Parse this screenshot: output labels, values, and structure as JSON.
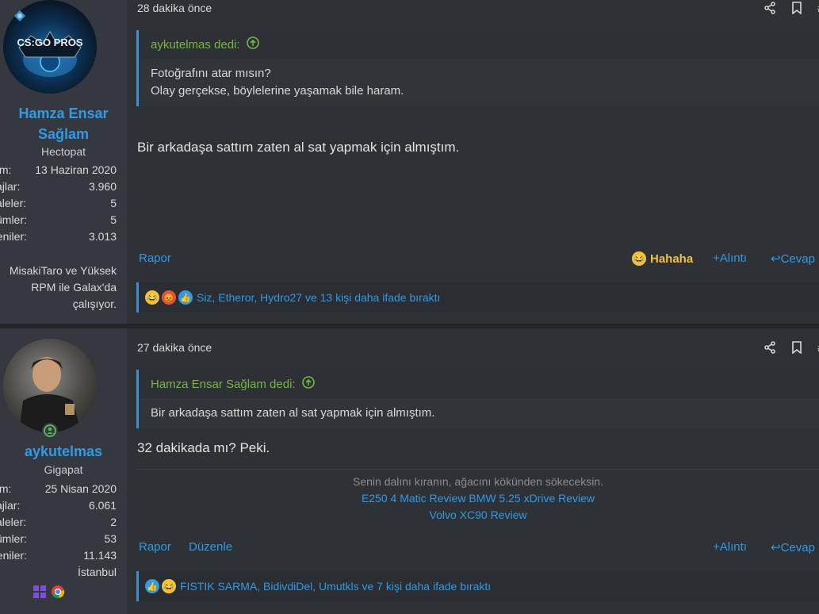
{
  "posts": [
    {
      "user": {
        "name_line1": "Hamza Ensar",
        "name_line2": "Sağlam",
        "title": "Hectopat"
      },
      "stats": [
        {
          "key": "ılım:",
          "value": "13 Haziran 2020"
        },
        {
          "key": "sajlar:",
          "value": "3.960"
        },
        {
          "key": "kaleler:",
          "value": "5"
        },
        {
          "key": "zümler:",
          "value": "5"
        },
        {
          "key": "ğeniler:",
          "value": "3.013"
        },
        {
          "key": ":",
          "value": ""
        }
      ],
      "extra_lines": [
        "MisakiTaro ve Yüksek",
        "RPM ile Galax'da",
        "çalışıyor."
      ],
      "time": "28 dakika önce",
      "quote": {
        "author": "aykutelmas dedi:",
        "lines": [
          "Fotoğrafını atar mısın?",
          "Olay gerçekse, böylelerine yaşamak bile haram."
        ]
      },
      "message": "Bir arkadaşa sattım zaten al sat yapmak için almıştım.",
      "actions": {
        "report": "Rapor",
        "reaction": "Hahaha",
        "quote": "Alıntı",
        "reply": "Cevap"
      },
      "reactions_text": "Siz, Etheror, Hydro27 ve 13 kişi daha ifade bıraktı"
    },
    {
      "user": {
        "name_line1": "aykutelmas",
        "title": "Gigapat"
      },
      "stats": [
        {
          "key": "ılım:",
          "value": "25 Nisan 2020"
        },
        {
          "key": "sajlar:",
          "value": "6.061"
        },
        {
          "key": "kaleler:",
          "value": "2"
        },
        {
          "key": "zümler:",
          "value": "53"
        },
        {
          "key": "ğeniler:",
          "value": "11.143"
        },
        {
          "key": ":",
          "value": "İstanbul"
        }
      ],
      "time": "27 dakika önce",
      "quote": {
        "author": "Hamza Ensar Sağlam dedi:",
        "lines": [
          "Bir arkadaşa sattım zaten al sat yapmak için almıştım."
        ]
      },
      "message": "32 dakikada mı? Peki.",
      "signature": {
        "motto": "Senin dalını kıranın, ağacını kökünden sökeceksin.",
        "link1": "E250 4 Matic Review BMW 5.25 xDrive Review",
        "link2": "Volvo XC90 Review"
      },
      "actions": {
        "report": "Rapor",
        "edit": "Düzenle",
        "quote": "Alıntı",
        "reply": "Cevap"
      },
      "reactions_text": "FISTIK SARMA, BidivdiDel, Umutkls ve 7 kişi daha ifade bıraktı"
    }
  ],
  "avatar1_label": "CS:GO PROS",
  "colors": {
    "link": "#2f9ae6",
    "quote_author": "#74b83e",
    "background": "#2e3136"
  }
}
